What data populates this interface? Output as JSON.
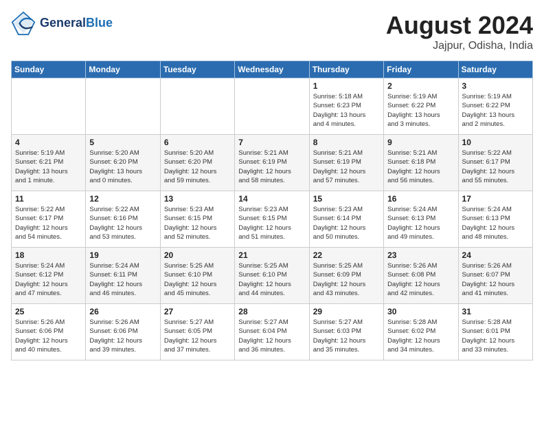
{
  "header": {
    "logo_line1": "General",
    "logo_line2": "Blue",
    "month_year": "August 2024",
    "location": "Jajpur, Odisha, India"
  },
  "days_of_week": [
    "Sunday",
    "Monday",
    "Tuesday",
    "Wednesday",
    "Thursday",
    "Friday",
    "Saturday"
  ],
  "weeks": [
    [
      {
        "day": "",
        "info": ""
      },
      {
        "day": "",
        "info": ""
      },
      {
        "day": "",
        "info": ""
      },
      {
        "day": "",
        "info": ""
      },
      {
        "day": "1",
        "info": "Sunrise: 5:18 AM\nSunset: 6:23 PM\nDaylight: 13 hours\nand 4 minutes."
      },
      {
        "day": "2",
        "info": "Sunrise: 5:19 AM\nSunset: 6:22 PM\nDaylight: 13 hours\nand 3 minutes."
      },
      {
        "day": "3",
        "info": "Sunrise: 5:19 AM\nSunset: 6:22 PM\nDaylight: 13 hours\nand 2 minutes."
      }
    ],
    [
      {
        "day": "4",
        "info": "Sunrise: 5:19 AM\nSunset: 6:21 PM\nDaylight: 13 hours\nand 1 minute."
      },
      {
        "day": "5",
        "info": "Sunrise: 5:20 AM\nSunset: 6:20 PM\nDaylight: 13 hours\nand 0 minutes."
      },
      {
        "day": "6",
        "info": "Sunrise: 5:20 AM\nSunset: 6:20 PM\nDaylight: 12 hours\nand 59 minutes."
      },
      {
        "day": "7",
        "info": "Sunrise: 5:21 AM\nSunset: 6:19 PM\nDaylight: 12 hours\nand 58 minutes."
      },
      {
        "day": "8",
        "info": "Sunrise: 5:21 AM\nSunset: 6:19 PM\nDaylight: 12 hours\nand 57 minutes."
      },
      {
        "day": "9",
        "info": "Sunrise: 5:21 AM\nSunset: 6:18 PM\nDaylight: 12 hours\nand 56 minutes."
      },
      {
        "day": "10",
        "info": "Sunrise: 5:22 AM\nSunset: 6:17 PM\nDaylight: 12 hours\nand 55 minutes."
      }
    ],
    [
      {
        "day": "11",
        "info": "Sunrise: 5:22 AM\nSunset: 6:17 PM\nDaylight: 12 hours\nand 54 minutes."
      },
      {
        "day": "12",
        "info": "Sunrise: 5:22 AM\nSunset: 6:16 PM\nDaylight: 12 hours\nand 53 minutes."
      },
      {
        "day": "13",
        "info": "Sunrise: 5:23 AM\nSunset: 6:15 PM\nDaylight: 12 hours\nand 52 minutes."
      },
      {
        "day": "14",
        "info": "Sunrise: 5:23 AM\nSunset: 6:15 PM\nDaylight: 12 hours\nand 51 minutes."
      },
      {
        "day": "15",
        "info": "Sunrise: 5:23 AM\nSunset: 6:14 PM\nDaylight: 12 hours\nand 50 minutes."
      },
      {
        "day": "16",
        "info": "Sunrise: 5:24 AM\nSunset: 6:13 PM\nDaylight: 12 hours\nand 49 minutes."
      },
      {
        "day": "17",
        "info": "Sunrise: 5:24 AM\nSunset: 6:13 PM\nDaylight: 12 hours\nand 48 minutes."
      }
    ],
    [
      {
        "day": "18",
        "info": "Sunrise: 5:24 AM\nSunset: 6:12 PM\nDaylight: 12 hours\nand 47 minutes."
      },
      {
        "day": "19",
        "info": "Sunrise: 5:24 AM\nSunset: 6:11 PM\nDaylight: 12 hours\nand 46 minutes."
      },
      {
        "day": "20",
        "info": "Sunrise: 5:25 AM\nSunset: 6:10 PM\nDaylight: 12 hours\nand 45 minutes."
      },
      {
        "day": "21",
        "info": "Sunrise: 5:25 AM\nSunset: 6:10 PM\nDaylight: 12 hours\nand 44 minutes."
      },
      {
        "day": "22",
        "info": "Sunrise: 5:25 AM\nSunset: 6:09 PM\nDaylight: 12 hours\nand 43 minutes."
      },
      {
        "day": "23",
        "info": "Sunrise: 5:26 AM\nSunset: 6:08 PM\nDaylight: 12 hours\nand 42 minutes."
      },
      {
        "day": "24",
        "info": "Sunrise: 5:26 AM\nSunset: 6:07 PM\nDaylight: 12 hours\nand 41 minutes."
      }
    ],
    [
      {
        "day": "25",
        "info": "Sunrise: 5:26 AM\nSunset: 6:06 PM\nDaylight: 12 hours\nand 40 minutes."
      },
      {
        "day": "26",
        "info": "Sunrise: 5:26 AM\nSunset: 6:06 PM\nDaylight: 12 hours\nand 39 minutes."
      },
      {
        "day": "27",
        "info": "Sunrise: 5:27 AM\nSunset: 6:05 PM\nDaylight: 12 hours\nand 37 minutes."
      },
      {
        "day": "28",
        "info": "Sunrise: 5:27 AM\nSunset: 6:04 PM\nDaylight: 12 hours\nand 36 minutes."
      },
      {
        "day": "29",
        "info": "Sunrise: 5:27 AM\nSunset: 6:03 PM\nDaylight: 12 hours\nand 35 minutes."
      },
      {
        "day": "30",
        "info": "Sunrise: 5:28 AM\nSunset: 6:02 PM\nDaylight: 12 hours\nand 34 minutes."
      },
      {
        "day": "31",
        "info": "Sunrise: 5:28 AM\nSunset: 6:01 PM\nDaylight: 12 hours\nand 33 minutes."
      }
    ]
  ]
}
